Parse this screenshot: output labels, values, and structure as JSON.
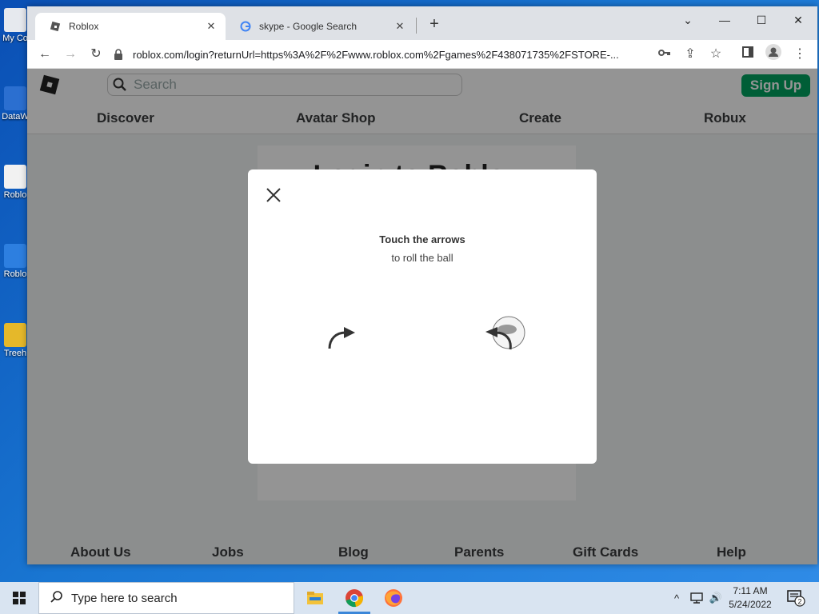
{
  "browser": {
    "tabs": [
      {
        "title": "Roblox"
      },
      {
        "title": "skype - Google Search"
      }
    ],
    "url": "roblox.com/login?returnUrl=https%3A%2F%2Fwww.roblox.com%2Fgames%2F438071735%2FSTORE-..."
  },
  "desktop_icons": [
    {
      "label": "My Co"
    },
    {
      "label": "DataW"
    },
    {
      "label": "Roblo"
    },
    {
      "label": "Roblo"
    },
    {
      "label": "Treeh"
    }
  ],
  "roblox": {
    "search_placeholder": "Search",
    "signup_label": "Sign Up",
    "nav": [
      "Discover",
      "Avatar Shop",
      "Create",
      "Robux"
    ],
    "login_heading": "Login to Roblox",
    "footer": [
      "About Us",
      "Jobs",
      "Blog",
      "Parents",
      "Gift Cards",
      "Help"
    ]
  },
  "captcha": {
    "title": "Touch the arrows",
    "subtitle": "to roll the ball"
  },
  "taskbar": {
    "search_placeholder": "Type here to search",
    "time": "7:11 AM",
    "date": "5/24/2022",
    "notifications": "2"
  },
  "colors": {
    "signup": "#00a35f",
    "desktop": "#1976d2"
  }
}
